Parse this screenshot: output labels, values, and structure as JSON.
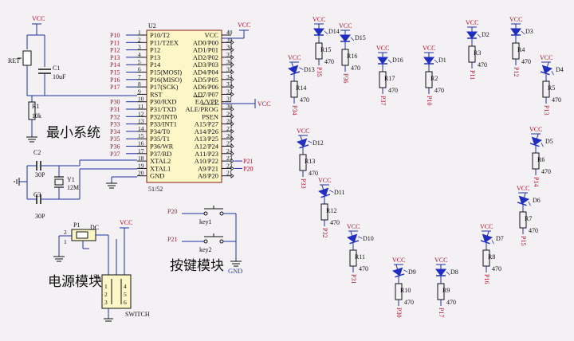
{
  "vcc_label": "VCC",
  "gnd_label": "GND",
  "mcu": {
    "ref": "U2",
    "part": "51/52",
    "left_pins": [
      "P10/T2",
      "P11/T2EX",
      "P12",
      "P13",
      "P14",
      "P15(MOSI)",
      "P16(MISO)",
      "P17(SCK)",
      "RST",
      "P30/RXD",
      "P31/TXD",
      "P32/INT0",
      "P33/INT1",
      "P34/T0",
      "P35/T1",
      "P36/WR",
      "P37/RD",
      "XTAL2",
      "XTAL1",
      "GND"
    ],
    "left_nums": [
      "1",
      "2",
      "3",
      "4",
      "5",
      "6",
      "7",
      "8",
      "9",
      "10",
      "11",
      "12",
      "13",
      "14",
      "15",
      "16",
      "17",
      "18",
      "19",
      "20"
    ],
    "right_pins": [
      "VCC",
      "AD0/P00",
      "AD1/P01",
      "AD2/P02",
      "AD3/P03",
      "AD4/P04",
      "AD5/P05",
      "AD6/P06",
      "AD7/P07",
      "EA/VPP",
      "ALE/PROG",
      "PSEN",
      "A15/P27",
      "A14/P26",
      "A13/P25",
      "A12/P24",
      "A11/P23",
      "A10/P22",
      "A9/P21",
      "A8/P20"
    ],
    "right_nums": [
      "40",
      "39",
      "38",
      "37",
      "36",
      "35",
      "34",
      "33",
      "32",
      "31",
      "30",
      "29",
      "28",
      "27",
      "26",
      "25",
      "24",
      "23",
      "22",
      "21"
    ],
    "left_nets": [
      "P10",
      "P11",
      "P12",
      "P13",
      "P14",
      "P15",
      "P16",
      "P17",
      "",
      "P30",
      "P31",
      "P32",
      "P33",
      "P34",
      "P35",
      "P36",
      "P37",
      "",
      "",
      ""
    ],
    "right_nets": [
      "",
      "",
      "",
      "",
      "",
      "",
      "",
      "",
      "",
      "",
      "",
      "",
      "",
      "",
      "",
      "",
      "",
      "P21",
      "P20",
      ""
    ]
  },
  "min_system": {
    "title": "最小系统",
    "reset_label": "RET",
    "c1_ref": "C1",
    "c1_val": "10uF",
    "r1_ref": "R1",
    "r1_val": "10k",
    "c2_ref": "C2",
    "c2_val": "30P",
    "c3_ref": "C3",
    "c3_val": "30P",
    "y1_ref": "Y1",
    "y1_val": "12M"
  },
  "power": {
    "title": "电源模块",
    "p1_ref": "P1",
    "p1_type": "DC",
    "s1_ref": "S1",
    "switch_label": "SWITCH",
    "pins": [
      "1",
      "2",
      "3",
      "4",
      "5",
      "6"
    ]
  },
  "keys": {
    "title": "按键模块",
    "items": [
      {
        "net": "P20",
        "label": "key1"
      },
      {
        "net": "P21",
        "label": "key2"
      }
    ]
  },
  "leds": [
    {
      "d": "D14",
      "r": "R15",
      "v": "470",
      "net": "P35"
    },
    {
      "d": "D15",
      "r": "R16",
      "v": "470",
      "net": "P36"
    },
    {
      "d": "D16",
      "r": "R17",
      "v": "470",
      "net": "P37"
    },
    {
      "d": "D1",
      "r": "R2",
      "v": "470",
      "net": "P10"
    },
    {
      "d": "D2",
      "r": "R3",
      "v": "470",
      "net": "P11"
    },
    {
      "d": "D3",
      "r": "R4",
      "v": "470",
      "net": "P12"
    },
    {
      "d": "D4",
      "r": "R5",
      "v": "470",
      "net": "P13"
    },
    {
      "d": "D5",
      "r": "R6",
      "v": "470",
      "net": "P14"
    },
    {
      "d": "D6",
      "r": "R7",
      "v": "470",
      "net": "P15"
    },
    {
      "d": "D7",
      "r": "R8",
      "v": "470",
      "net": "P16"
    },
    {
      "d": "D8",
      "r": "R9",
      "v": "470",
      "net": "P17"
    },
    {
      "d": "D9",
      "r": "R10",
      "v": "470",
      "net": "P30"
    },
    {
      "d": "D10",
      "r": "R11",
      "v": "470",
      "net": "P31"
    },
    {
      "d": "D11",
      "r": "R12",
      "v": "470",
      "net": "P32"
    },
    {
      "d": "D12",
      "r": "R13",
      "v": "470",
      "net": "P33"
    },
    {
      "d": "D13",
      "r": "R14",
      "v": "470",
      "net": "P34"
    }
  ]
}
